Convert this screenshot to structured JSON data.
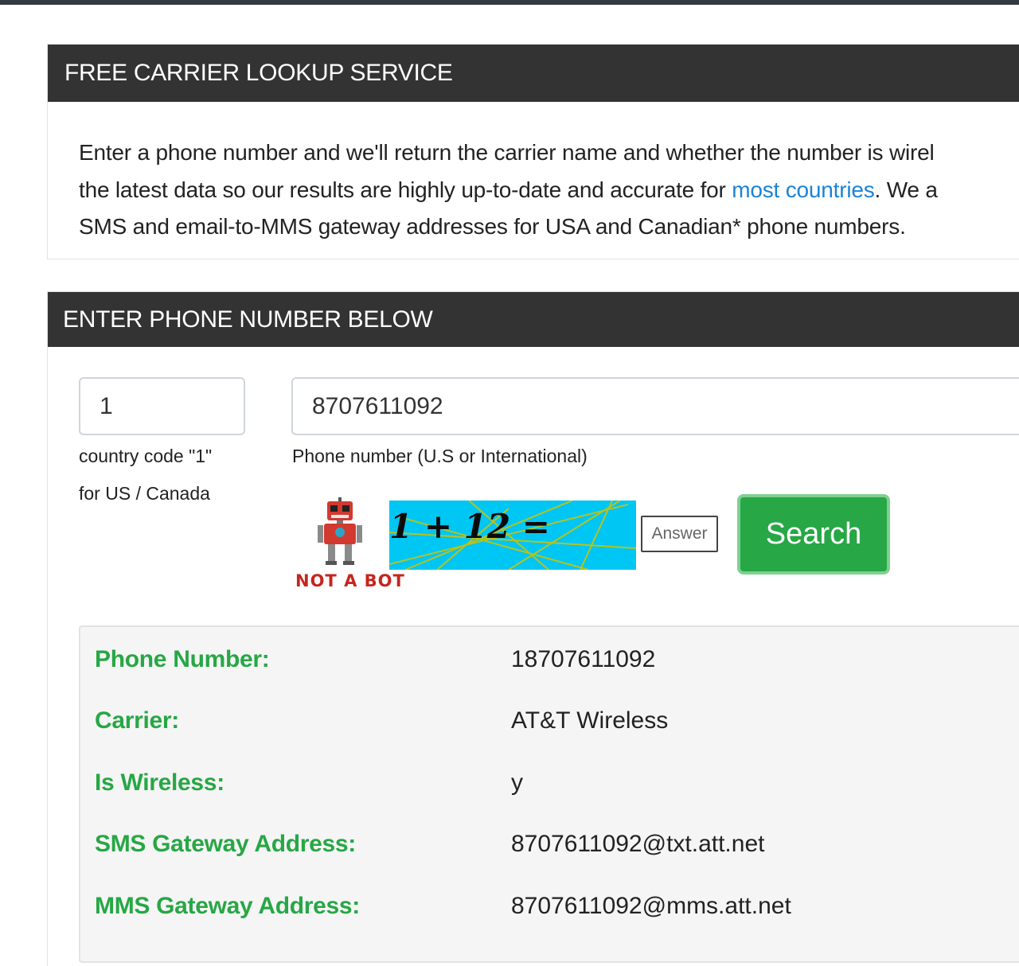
{
  "intro": {
    "title": "FREE CARRIER LOOKUP SERVICE",
    "line1": "Enter a phone number and we'll return the carrier name and whether the number is wirel",
    "line2_before": "the latest data so our results are highly up-to-date and accurate for ",
    "line2_link": "most countries",
    "line2_after": ". We a",
    "line3": "SMS and email-to-MMS gateway addresses for USA and Canadian* phone numbers."
  },
  "form": {
    "title": "ENTER PHONE NUMBER BELOW",
    "country_code_value": "1",
    "country_code_help_1": "country code \"1\"",
    "country_code_help_2": "for US / Canada",
    "phone_value": "8707611092",
    "phone_help": "Phone number (U.S or International)",
    "captcha_badge": "NOT A BOT",
    "captcha_question": "1 + 12 =",
    "answer_placeholder": "Answer",
    "search_label": "Search"
  },
  "results": [
    {
      "label": "Phone Number:",
      "value": "18707611092"
    },
    {
      "label": "Carrier:",
      "value": "AT&T Wireless"
    },
    {
      "label": "Is Wireless:",
      "value": "y"
    },
    {
      "label": "SMS Gateway Address:",
      "value": "8707611092@txt.att.net"
    },
    {
      "label": "MMS Gateway Address:",
      "value": "8707611092@mms.att.net"
    }
  ],
  "colors": {
    "header_bg": "#333333",
    "accent_green": "#27a745",
    "link_blue": "#1a83d8",
    "captcha_bg": "#00c6f4",
    "robot_red": "#c4261e"
  }
}
